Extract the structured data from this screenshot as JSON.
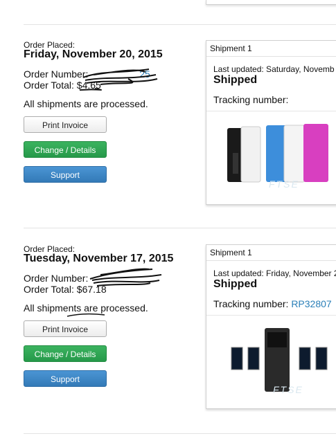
{
  "orders": [
    {
      "placed_label": "Order Placed:",
      "date": "Friday, November 20, 2015",
      "order_number_label": "Order Number:",
      "order_number_visible": "25",
      "order_total_label": "Order Total:",
      "order_total_value": "$4.65",
      "processed_text": "All shipments are processed.",
      "buttons": {
        "print": "Print Invoice",
        "change": "Change / Details",
        "support": "Support"
      },
      "shipment": {
        "header": "Shipment 1",
        "last_updated": "Last updated: Saturday, Novemb",
        "status": "Shipped",
        "tracking_label": "Tracking number:",
        "tracking_value": ""
      }
    },
    {
      "placed_label": "Order Placed:",
      "date": "Tuesday, November 17, 2015",
      "order_number_label": "Order Number:",
      "order_number_visible": "",
      "order_total_label": "Order Total:",
      "order_total_value": "$67.18",
      "processed_text": "All shipments are processed.",
      "buttons": {
        "print": "Print Invoice",
        "change": "Change / Details",
        "support": "Support"
      },
      "shipment": {
        "header": "Shipment 1",
        "last_updated": "Last updated: Friday, November 2",
        "status": "Shipped",
        "tracking_label": "Tracking number:",
        "tracking_value": "RP32807"
      }
    }
  ],
  "colors": {
    "link": "#2a7fb8",
    "green_button": "#26994a",
    "blue_button": "#337ab7"
  }
}
